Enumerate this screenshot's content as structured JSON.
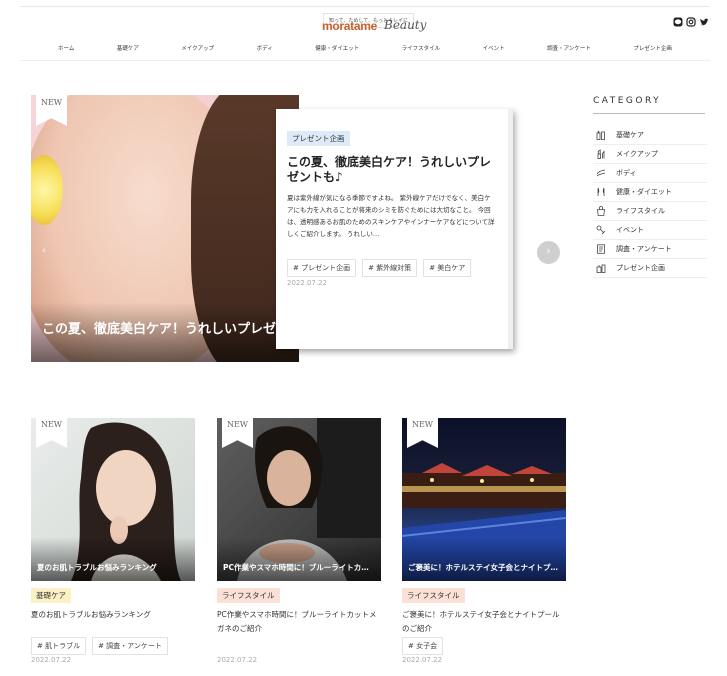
{
  "header": {
    "tagline": "知って、ためして、もっとキレイに",
    "brand": "moratame",
    "brand_suffix": "Beauty",
    "social_icons": [
      "line-icon",
      "instagram-icon",
      "twitter-icon"
    ]
  },
  "nav": {
    "items": [
      "ホーム",
      "基礎ケア",
      "メイクアップ",
      "ボディ",
      "健康・ダイエット",
      "ライフスタイル",
      "イベント",
      "調査・アンケート",
      "プレゼント企画"
    ]
  },
  "hero": {
    "ribbon": "NEW",
    "image_title": "この夏、徹底美白ケア！うれしいプレゼント…",
    "category": "プレゼント企画",
    "title": "この夏、徹底美白ケア！うれしいプレゼントも♪",
    "excerpt": "夏は紫外線が気になる季節ですよね。 紫外線ケアだけでなく、美白ケアにも力を入れることが将来のシミを防ぐためには大切なこと。 今回は、透明感あるお肌のためのスキンケアやインナーケアなどについて詳しくご紹介します。 うれしい…",
    "tags": [
      "# プレゼント企画",
      "# 紫外線対策",
      "# 美白ケア"
    ],
    "date": "2022.07.22",
    "prev_label": "‹",
    "next_label": "›"
  },
  "sidebar": {
    "title": "CATEGORY",
    "items": [
      {
        "label": "基礎ケア",
        "icon": "bottles-icon"
      },
      {
        "label": "メイクアップ",
        "icon": "lipstick-icon"
      },
      {
        "label": "ボディ",
        "icon": "body-icon"
      },
      {
        "label": "健康・ダイエット",
        "icon": "diet-icon"
      },
      {
        "label": "ライフスタイル",
        "icon": "bag-icon"
      },
      {
        "label": "イベント",
        "icon": "event-icon"
      },
      {
        "label": "調査・アンケート",
        "icon": "survey-icon"
      },
      {
        "label": "プレゼント企画",
        "icon": "gift-icon"
      }
    ]
  },
  "posts": [
    {
      "ribbon": "NEW",
      "image_title": "夏のお肌トラブルお悩みランキング",
      "category": "基礎ケア",
      "category_color": "#fbf1c5",
      "title": "夏のお肌トラブルお悩みランキング",
      "tags": [
        "# 肌トラブル",
        "# 調査・アンケート"
      ],
      "date": "2022.07.22"
    },
    {
      "ribbon": "NEW",
      "image_title": "PC作業やスマホ時間に！ブルーライトカ…",
      "category": "ライフスタイル",
      "category_color": "#fbe0d6",
      "title": "PC作業やスマホ時間に！ブルーライトカットメガネのご紹介",
      "tags": [],
      "date": "2022.07.22"
    },
    {
      "ribbon": "NEW",
      "image_title": "ご褒美に！ホテルステイ女子会とナイトプ…",
      "category": "ライフスタイル",
      "category_color": "#fbe0d6",
      "title": "ご褒美に！ホテルステイ女子会とナイトプールのご紹介",
      "tags": [
        "# 女子会"
      ],
      "date": "2022.07.22"
    }
  ]
}
